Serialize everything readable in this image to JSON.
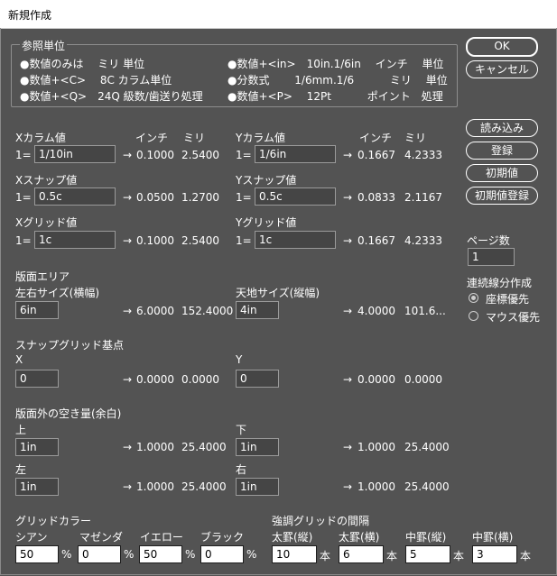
{
  "window": {
    "title": "新規作成"
  },
  "units_group": {
    "title": "参照単位",
    "rows": [
      {
        "left": "●数値のみは　 ミリ 単位",
        "right": "●数値+<in>　10in.1/6in　 インチ　 単位"
      },
      {
        "left": "●数値+<C>　 8C カラム単位",
        "right": "●分数式　　 1/6mm.1/6　　　 ミリ　 単位"
      },
      {
        "left": "●数値+<Q>　24Q 級数/歯送り処理",
        "right": "●数値+<P>　 12Pt　　　 ポイント　処理"
      }
    ]
  },
  "buttons": {
    "ok": "OK",
    "cancel": "キャンセル",
    "load": "読み込み",
    "register": "登録",
    "defaults": "初期値",
    "register_defaults": "初期値登録"
  },
  "common": {
    "prefix": "1=",
    "arrow": "→",
    "unit_inch": "インチ",
    "unit_mm": "ミリ"
  },
  "column": {
    "x": {
      "label": "Xカラム値",
      "value": "1/10in",
      "inch": "0.1000",
      "mm": "2.5400"
    },
    "y": {
      "label": "Yカラム値",
      "value": "1/6in",
      "inch": "0.1667",
      "mm": "4.2333"
    }
  },
  "snap": {
    "x": {
      "label": "Xスナップ値",
      "value": "0.5c",
      "inch": "0.0500",
      "mm": "1.2700"
    },
    "y": {
      "label": "Yスナップ値",
      "value": "0.5c",
      "inch": "0.0833",
      "mm": "2.1167"
    }
  },
  "grid": {
    "x": {
      "label": "Xグリッド値",
      "value": "1c",
      "inch": "0.1000",
      "mm": "2.5400"
    },
    "y": {
      "label": "Yグリッド値",
      "value": "1c",
      "inch": "0.1667",
      "mm": "4.2333"
    }
  },
  "page_count": {
    "label": "ページ数",
    "value": "1"
  },
  "continuous": {
    "label": "連続線分作成",
    "option1": "座標優先",
    "option2": "マウス優先"
  },
  "page_area": {
    "label": "版面エリア",
    "width": {
      "label": "左右サイズ(横幅)",
      "value": "6in",
      "inch": "6.0000",
      "mm": "152.4000"
    },
    "height": {
      "label": "天地サイズ(縦幅)",
      "value": "4in",
      "inch": "4.0000",
      "mm": "101.6..."
    }
  },
  "snap_origin": {
    "label": "スナップグリッド基点",
    "x": {
      "label": "X",
      "value": "0",
      "inch": "0.0000",
      "mm": "0.0000"
    },
    "y": {
      "label": "Y",
      "value": "0",
      "inch": "0.0000",
      "mm": "0.0000"
    }
  },
  "margins": {
    "label": "版面外の空き量(余白)",
    "top": {
      "label": "上",
      "value": "1in",
      "inch": "1.0000",
      "mm": "25.4000"
    },
    "bottom": {
      "label": "下",
      "value": "1in",
      "inch": "1.0000",
      "mm": "25.4000"
    },
    "left": {
      "label": "左",
      "value": "1in",
      "inch": "1.0000",
      "mm": "25.4000"
    },
    "right": {
      "label": "右",
      "value": "1in",
      "inch": "1.0000",
      "mm": "25.4000"
    }
  },
  "grid_color": {
    "label": "グリッドカラー",
    "percent": "%",
    "cyan": {
      "label": "シアン",
      "value": "50"
    },
    "magenta": {
      "label": "マゼンダ",
      "value": "0"
    },
    "yellow": {
      "label": "イエロー",
      "value": "50"
    },
    "black": {
      "label": "ブラック",
      "value": "0"
    }
  },
  "emphasis": {
    "label": "強調グリッドの間隔",
    "unit": "本",
    "thick_v": {
      "label": "太罫(縦)",
      "value": "10"
    },
    "thick_h": {
      "label": "太罫(横)",
      "value": "6"
    },
    "mid_v": {
      "label": "中罫(縦)",
      "value": "5"
    },
    "mid_h": {
      "label": "中罫(横)",
      "value": "3"
    }
  }
}
